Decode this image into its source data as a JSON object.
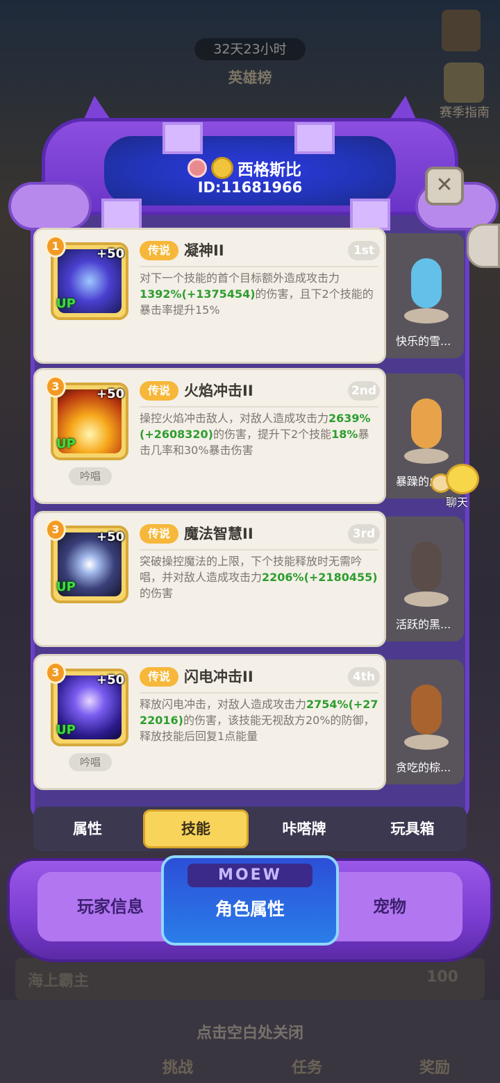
{
  "background": {
    "timer": "32天23小时",
    "rank_title": "英雄榜",
    "guide_label": "赛季指南",
    "footer_row": {
      "name": "海上霸主",
      "score": "100"
    },
    "close_hint": "点击空白处关闭",
    "bottom_tabs": [
      "挑战",
      "任务",
      "奖励"
    ]
  },
  "header": {
    "player_name": "西格斯比",
    "player_id": "ID:11681966",
    "close_label": "✕"
  },
  "skills": [
    {
      "level": "1",
      "plus": "+50",
      "up": "UP",
      "rarity": "传说",
      "name": "凝神II",
      "rank": "1st",
      "desc_parts": [
        "对下一个技能的首个目标额外造成攻击力",
        "1392%(+1375454)",
        "的伤害，且下2个技能的暴击率提升15%"
      ],
      "chant": "",
      "pet_name": "快乐的雪..."
    },
    {
      "level": "3",
      "plus": "+50",
      "up": "UP",
      "rarity": "传说",
      "name": "火焰冲击II",
      "rank": "2nd",
      "desc_parts": [
        "操控火焰冲击敌人，对敌人造成攻击力",
        "2639%(+2608320)",
        "的伤害，提升下2个技能",
        "18%",
        "暴击几率和30%暴击伤害"
      ],
      "chant": "吟唱",
      "pet_name": "暴躁的虎..."
    },
    {
      "level": "3",
      "plus": "+50",
      "up": "UP",
      "rarity": "传说",
      "name": "魔法智慧II",
      "rank": "3rd",
      "desc_parts": [
        "突破操控魔法的上限，下个技能释放时无需吟唱，并对敌人造成攻击力",
        "2206%(+2180455)",
        "的伤害"
      ],
      "chant": "",
      "pet_name": "活跃的黑..."
    },
    {
      "level": "3",
      "plus": "+50",
      "up": "UP",
      "rarity": "传说",
      "name": "闪电冲击II",
      "rank": "4th",
      "desc_parts": [
        "释放闪电冲击，对敌人造成攻击力",
        "2754%(+2722016)",
        "的伤害，该技能无视敌方20%的防御，释放技能后回复1点能量"
      ],
      "chant": "吟唱",
      "pet_name": "贪吃的棕..."
    }
  ],
  "tabs": [
    "属性",
    "技能",
    "咔嗒牌",
    "玩具箱"
  ],
  "active_tab_index": 1,
  "bottom_nav": {
    "left": "玩家信息",
    "center_logo": "MOEW",
    "center": "角色属性",
    "right": "宠物"
  },
  "chat_label": "聊天",
  "colors": {
    "frame_purple": "#6a3fc6",
    "rarity_orange": "#f6b73a",
    "highlight_green": "#2e9d2e",
    "active_tab_yellow": "#f8d55a"
  }
}
